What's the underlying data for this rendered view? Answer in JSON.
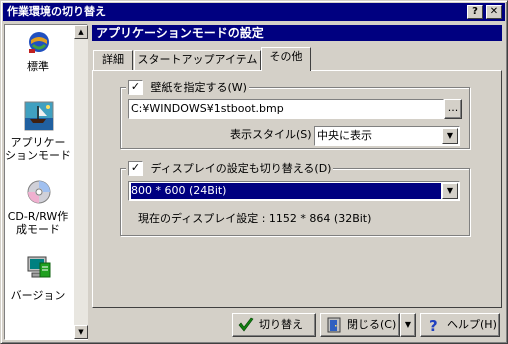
{
  "window": {
    "title": "作業環境の切り替え"
  },
  "title_buttons": {
    "help": "?",
    "close": "✕"
  },
  "sidebar": {
    "items": [
      {
        "label_line1": "標準",
        "label_line2": "",
        "icon": "standard-icon"
      },
      {
        "label_line1": "アプリケー",
        "label_line2": "ションモード",
        "icon": "application-mode-icon"
      },
      {
        "label_line1": "CD-R/RW作",
        "label_line2": "成モード",
        "icon": "cd-disc-icon"
      },
      {
        "label_line1": "バージョン",
        "label_line2": "",
        "icon": "version-icon"
      }
    ]
  },
  "header": {
    "title": "アプリケーションモードの設定"
  },
  "tabs": [
    {
      "label": "詳細"
    },
    {
      "label": "スタートアップアイテム"
    },
    {
      "label": "その他"
    }
  ],
  "wallpaper": {
    "label": "壁紙を指定する(W)",
    "checked": "✓",
    "path": "C:¥WINDOWS¥1stboot.bmp",
    "browse_label": "...",
    "style_label": "表示スタイル(S)",
    "style_value": "中央に表示"
  },
  "display": {
    "label": "ディスプレイの設定も切り替える(D)",
    "checked": "✓",
    "selected": "800 * 600 (24Bit)",
    "current": "現在のディスプレイ設定 : 1152 * 864 (32Bit)"
  },
  "footer": {
    "switch_label": "切り替え",
    "close_label": "閉じる(C)",
    "help_label": "ヘルプ(H)"
  },
  "colors": {
    "titlebar": "#000080",
    "selection": "#000080",
    "face": "#d4d0c8"
  }
}
